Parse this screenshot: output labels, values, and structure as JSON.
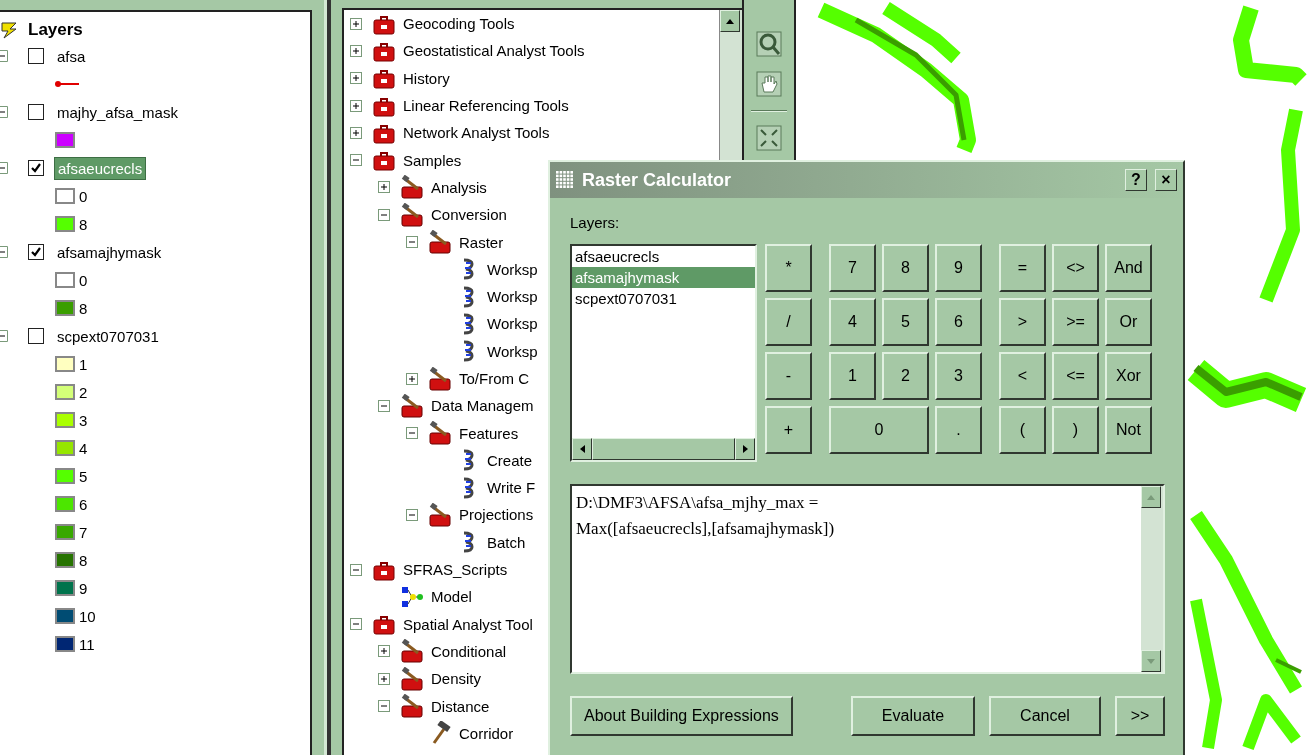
{
  "toc": {
    "title": "Layers",
    "layers": [
      {
        "name": "afsa",
        "checked": false,
        "selected": false,
        "legend": [
          {
            "kind": "line",
            "color": "#e00000"
          }
        ]
      },
      {
        "name": "majhy_afsa_mask",
        "checked": false,
        "selected": false,
        "legend": [
          {
            "kind": "fill",
            "color": "#cc00ff"
          }
        ]
      },
      {
        "name": "afsaeucrecls",
        "checked": true,
        "selected": true,
        "legend": [
          {
            "kind": "fill",
            "label": "0",
            "color": "#ffffff"
          },
          {
            "kind": "fill",
            "label": "8",
            "color": "#55ff00"
          }
        ]
      },
      {
        "name": "afsamajhymask",
        "checked": true,
        "selected": false,
        "legend": [
          {
            "kind": "fill",
            "label": "0",
            "color": "#ffffff"
          },
          {
            "kind": "fill",
            "label": "8",
            "color": "#3a9e00"
          }
        ]
      },
      {
        "name": "scpext0707031",
        "checked": false,
        "selected": false,
        "legend": [
          {
            "kind": "fill",
            "label": "1",
            "color": "#ffffc0"
          },
          {
            "kind": "fill",
            "label": "2",
            "color": "#d4ff78"
          },
          {
            "kind": "fill",
            "label": "3",
            "color": "#aaff00"
          },
          {
            "kind": "fill",
            "label": "4",
            "color": "#96e600"
          },
          {
            "kind": "fill",
            "label": "5",
            "color": "#55ff00"
          },
          {
            "kind": "fill",
            "label": "6",
            "color": "#4ce600"
          },
          {
            "kind": "fill",
            "label": "7",
            "color": "#38a800"
          },
          {
            "kind": "fill",
            "label": "8",
            "color": "#267300"
          },
          {
            "kind": "fill",
            "label": "9",
            "color": "#00734c"
          },
          {
            "kind": "fill",
            "label": "10",
            "color": "#004c73"
          },
          {
            "kind": "fill",
            "label": "11",
            "color": "#002673"
          }
        ]
      }
    ]
  },
  "tree": [
    {
      "label": "Geocoding Tools",
      "kind": "toolbox",
      "expanded": false
    },
    {
      "label": "Geostatistical Analyst Tools",
      "kind": "toolbox",
      "expanded": false
    },
    {
      "label": "History",
      "kind": "toolbox",
      "expanded": false
    },
    {
      "label": "Linear Referencing Tools",
      "kind": "toolbox",
      "expanded": false
    },
    {
      "label": "Network Analyst Tools",
      "kind": "toolbox",
      "expanded": false
    },
    {
      "label": "Samples",
      "kind": "toolbox",
      "expanded": true,
      "children": [
        {
          "label": "Analysis",
          "kind": "toolset",
          "expanded": false
        },
        {
          "label": "Conversion",
          "kind": "toolset",
          "expanded": true,
          "children": [
            {
              "label": "Raster",
              "kind": "toolset",
              "expanded": true,
              "children": [
                {
                  "label": "Worksp",
                  "kind": "script"
                },
                {
                  "label": "Worksp",
                  "kind": "script"
                },
                {
                  "label": "Worksp",
                  "kind": "script"
                },
                {
                  "label": "Worksp",
                  "kind": "script"
                }
              ]
            },
            {
              "label": "To/From C",
              "kind": "toolset",
              "expanded": false
            }
          ]
        },
        {
          "label": "Data Managem",
          "kind": "toolset",
          "expanded": true,
          "children": [
            {
              "label": "Features",
              "kind": "toolset",
              "expanded": true,
              "children": [
                {
                  "label": "Create",
                  "kind": "script"
                },
                {
                  "label": "Write F",
                  "kind": "script"
                }
              ]
            },
            {
              "label": "Projections",
              "kind": "toolset",
              "expanded": true,
              "children": [
                {
                  "label": "Batch",
                  "kind": "script"
                }
              ]
            }
          ]
        }
      ]
    },
    {
      "label": "SFRAS_Scripts",
      "kind": "toolbox",
      "expanded": true,
      "children": [
        {
          "label": "Model",
          "kind": "model"
        }
      ]
    },
    {
      "label": "Spatial Analyst Tool",
      "kind": "toolbox",
      "expanded": true,
      "children": [
        {
          "label": "Conditional",
          "kind": "toolset",
          "expanded": false
        },
        {
          "label": "Density",
          "kind": "toolset",
          "expanded": false
        },
        {
          "label": "Distance",
          "kind": "toolset",
          "expanded": true,
          "children": [
            {
              "label": "Corridor",
              "kind": "tool"
            }
          ]
        }
      ]
    }
  ],
  "dialog": {
    "title": "Raster Calculator",
    "help": "?",
    "close": "×",
    "layers_label": "Layers:",
    "layers": [
      {
        "name": "afsaeucrecls",
        "selected": false
      },
      {
        "name": "afsamajhymask",
        "selected": true
      },
      {
        "name": "scpext0707031",
        "selected": false
      }
    ],
    "operator_keys": [
      "*",
      "/",
      "-",
      "+"
    ],
    "digit_keys": [
      {
        "label": "7",
        "wide": false
      },
      {
        "label": "8",
        "wide": false
      },
      {
        "label": "9",
        "wide": false
      },
      {
        "label": "4",
        "wide": false
      },
      {
        "label": "5",
        "wide": false
      },
      {
        "label": "6",
        "wide": false
      },
      {
        "label": "1",
        "wide": false
      },
      {
        "label": "2",
        "wide": false
      },
      {
        "label": "3",
        "wide": false
      },
      {
        "label": "0",
        "wide": true
      },
      {
        "label": ".",
        "wide": false
      }
    ],
    "logic_keys": [
      "=",
      "<>",
      "And",
      ">",
      ">=",
      "Or",
      "<",
      "<=",
      "Xor",
      "(",
      ")",
      "Not"
    ],
    "expression": "D:\\DMF3\\AFSA\\afsa_mjhy_max =\nMax([afsaeucrecls],[afsamajhymask])",
    "buttons": [
      "About Building Expressions",
      "Evaluate",
      "Cancel",
      ">>"
    ]
  }
}
